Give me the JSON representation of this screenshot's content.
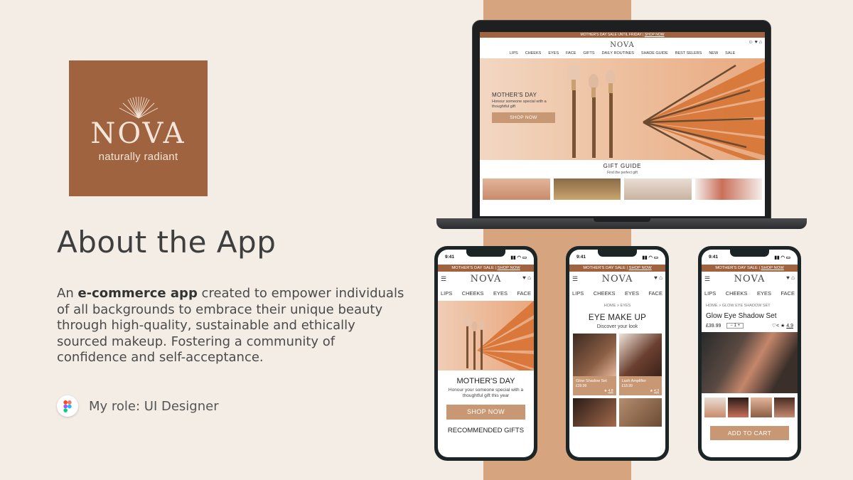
{
  "brand": {
    "name": "NOVA",
    "tagline": "naturally radiant",
    "color": "#a0633f"
  },
  "heading": "About the App",
  "description": {
    "pre": "An ",
    "bold": "e-commerce app",
    "post": " created to empower individuals of all backgrounds to embrace their unique beauty through high-quality, sustainable and ethically sourced makeup. Fostering a community of confidence and self-acceptance."
  },
  "role": "My role: UI Designer",
  "desktop": {
    "announcement": "MOTHER'S DAY SALE UNTIL FRIDAY |",
    "announcement_link": "SHOP NOW",
    "logo": "NOVA",
    "nav": [
      "LIPS",
      "CHEEKS",
      "EYES",
      "FACE",
      "GIFTS",
      "DAILY ROUTINES",
      "SHADE GUIDE",
      "BEST SELERS",
      "NEW",
      "SALE"
    ],
    "hero_title": "MOTHER'S DAY",
    "hero_sub": "Honour someone special with a thoughtful gift",
    "hero_button": "SHOP NOW",
    "section_title": "GIFT GUIDE",
    "section_sub": "Find the perfect gift"
  },
  "phone1": {
    "time": "9:41",
    "announcement": "MOTHER'S DAY SALE |",
    "announcement_link": "SHOP NOW",
    "logo": "NOVA",
    "nav": [
      "LIPS",
      "CHEEKS",
      "EYES",
      "FACE"
    ],
    "title": "MOTHER'S DAY",
    "sub": "Honour your someone special with a thoughtful gift this year",
    "button": "SHOP NOW",
    "section": "RECOMMENDED GIFTS"
  },
  "phone2": {
    "time": "9:41",
    "announcement": "MOTHER'S DAY SALE |",
    "announcement_link": "SHOP NOW",
    "logo": "NOVA",
    "nav": [
      "LIPS",
      "CHEEKS",
      "EYES",
      "FACE"
    ],
    "breadcrumb": "HOME > EYES",
    "title": "EYE MAKE UP",
    "sub": "Discover your look",
    "products": [
      {
        "name": "Glow Shadow Set",
        "price": "£39.99",
        "rating": "4.8"
      },
      {
        "name": "Lash Amplifier",
        "price": "£18.99",
        "rating": "4.3"
      }
    ]
  },
  "phone3": {
    "time": "9:41",
    "announcement": "MOTHER'S DAY SALE |",
    "announcement_link": "SHOP NOW",
    "logo": "NOVA",
    "nav": [
      "LIPS",
      "CHEEKS",
      "EYES",
      "FACE"
    ],
    "breadcrumb": "HOME > GLOW EYE SHADOW SET",
    "title": "Glow Eye Shadow Set",
    "price": "£39.99",
    "qty": "1",
    "rating": "4.9",
    "button": "ADD TO CART"
  }
}
